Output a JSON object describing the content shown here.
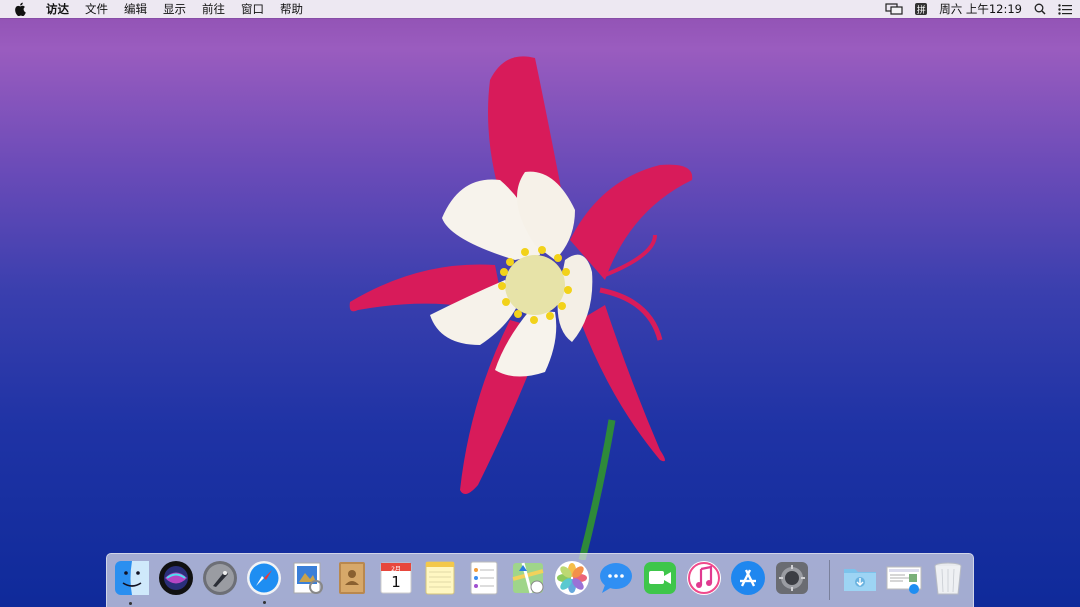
{
  "menubar": {
    "app_name": "访达",
    "menus": [
      "文件",
      "编辑",
      "显示",
      "前往",
      "窗口",
      "帮助"
    ],
    "input_method": "拼",
    "clock": "周六 上午12:19"
  },
  "dock": {
    "apps": [
      "Finder",
      "Siri",
      "Launchpad",
      "Safari",
      "Preview",
      "Contacts",
      "Calendar",
      "Notes",
      "Reminders",
      "Maps",
      "Photos",
      "Messages",
      "FaceTime",
      "iTunes",
      "App Store",
      "System Preferences"
    ],
    "calendar_month": "2月",
    "calendar_day": "1",
    "running_apps": [
      "Finder",
      "Safari"
    ]
  }
}
